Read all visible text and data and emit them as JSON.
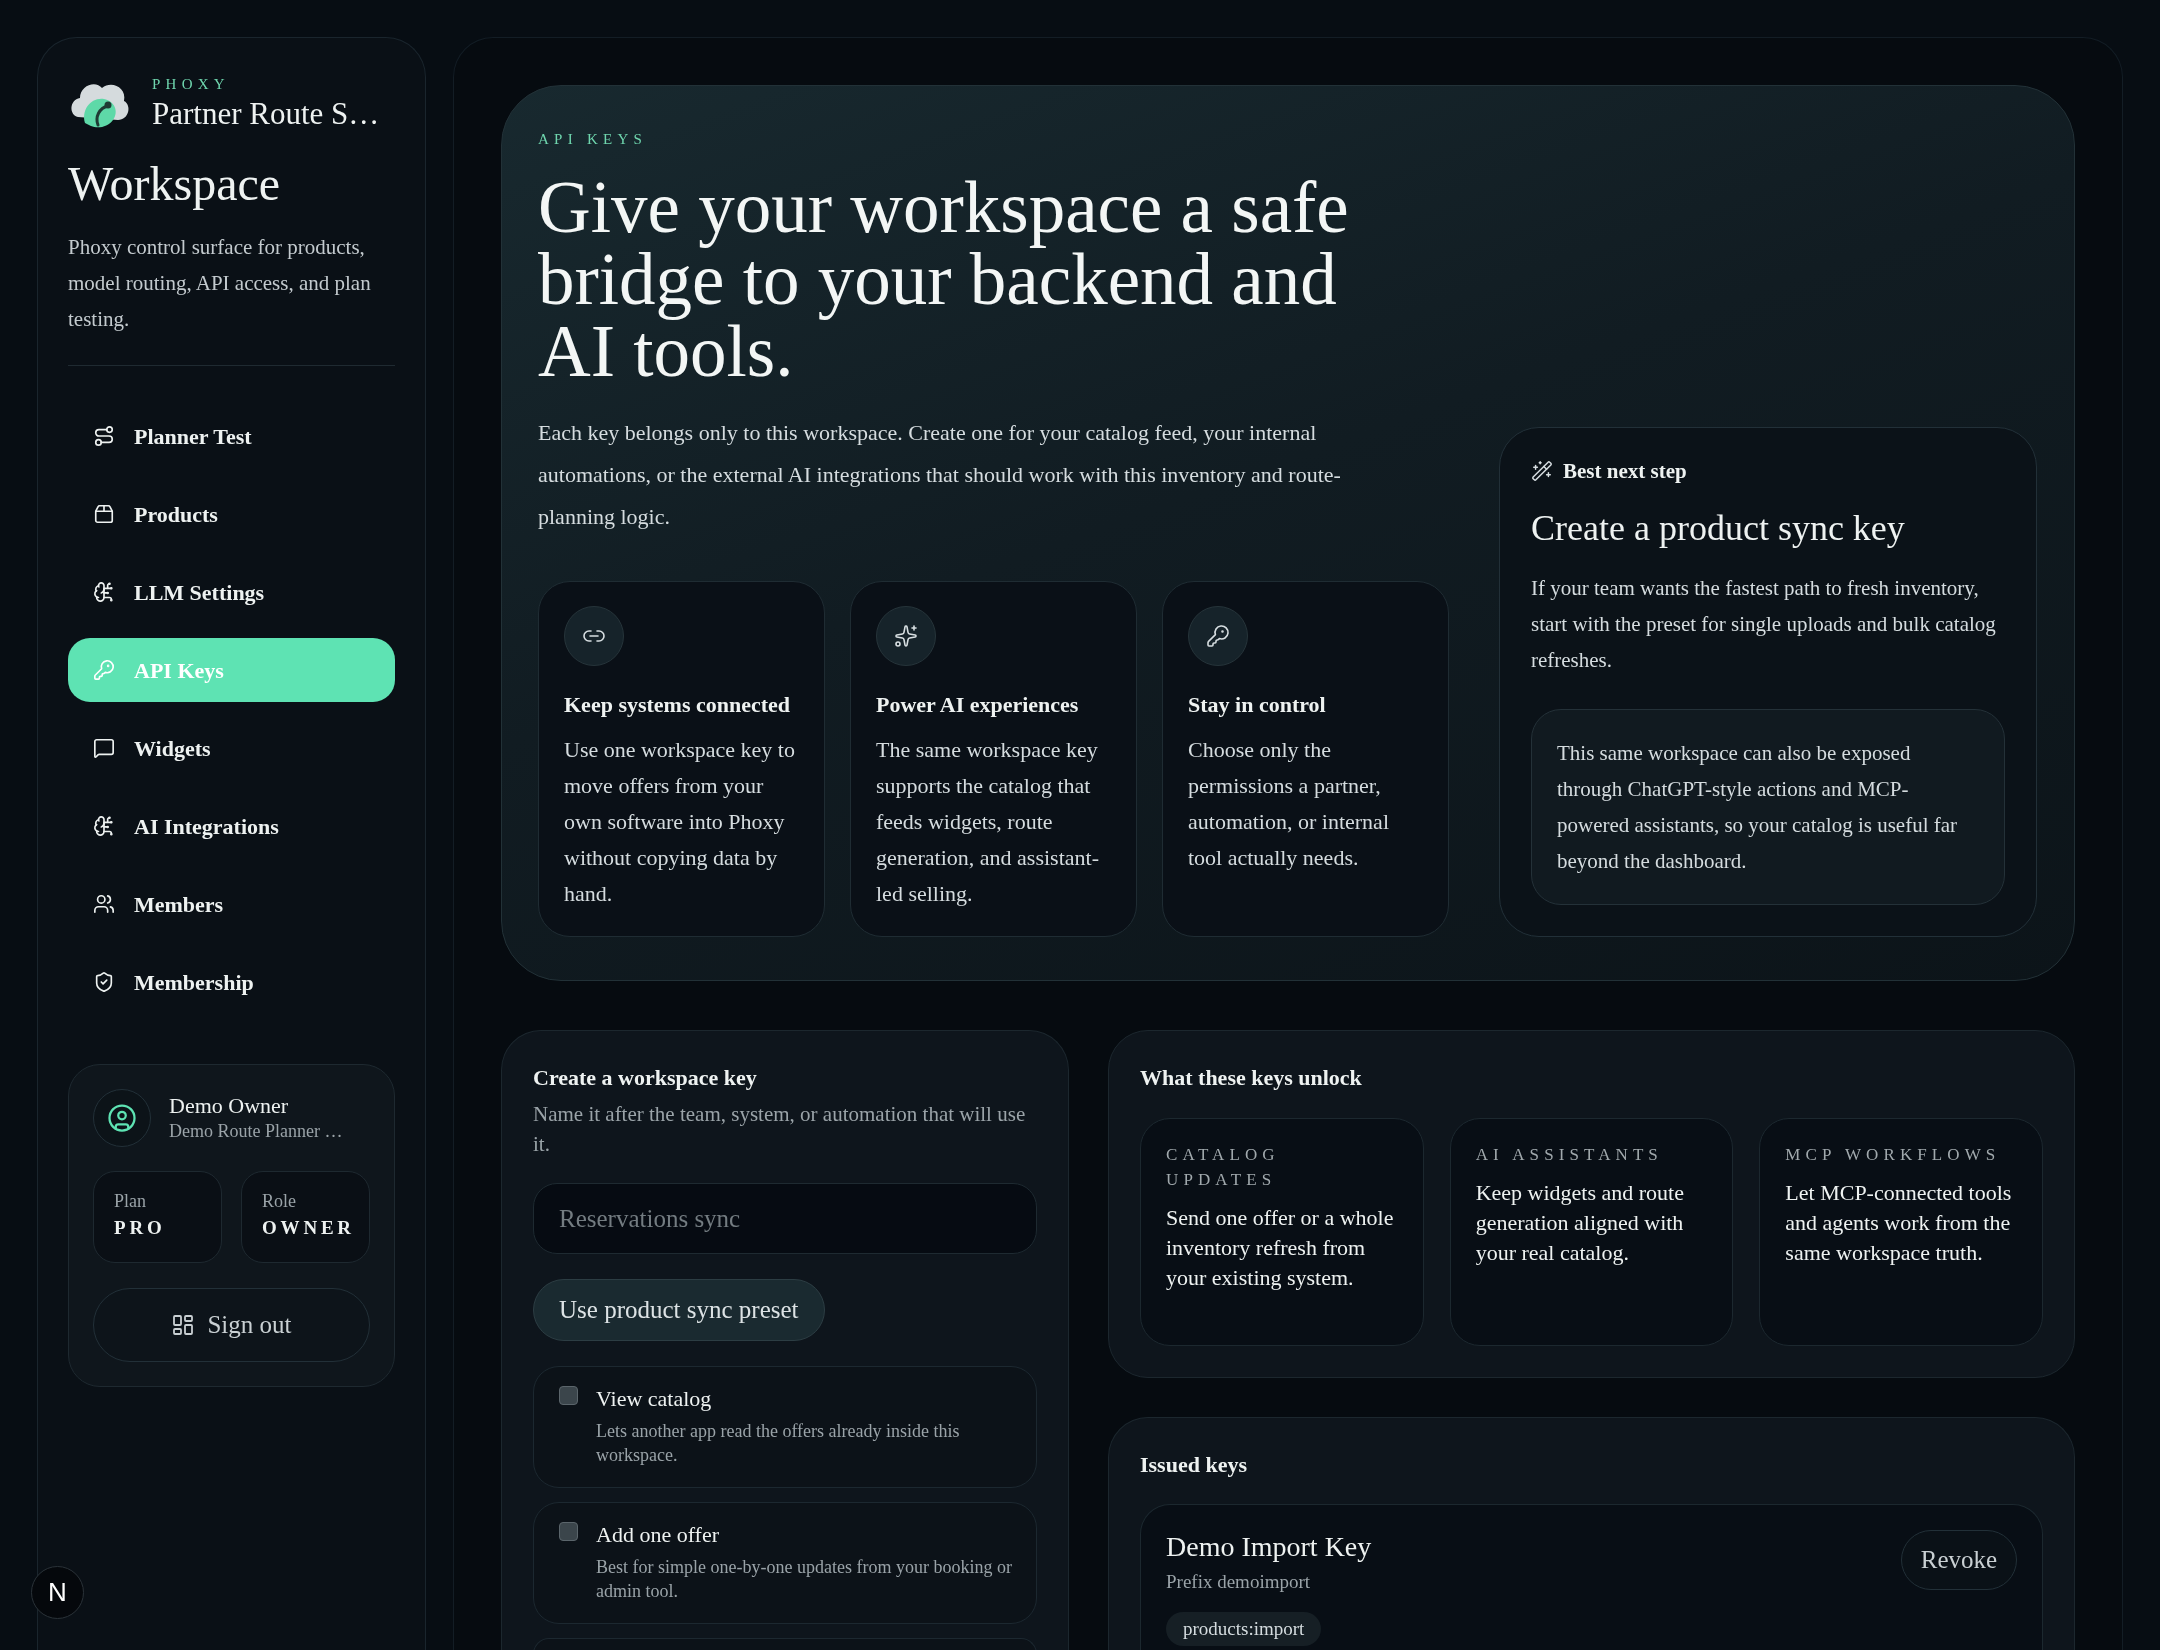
{
  "sidebar": {
    "brand": "PHOXY",
    "workspace_name": "Partner Route S…",
    "title": "Workspace",
    "description": "Phoxy control surface for products, model routing, API access, and plan testing.",
    "nav": [
      {
        "label": "Planner Test",
        "selected": false
      },
      {
        "label": "Products",
        "selected": false
      },
      {
        "label": "LLM Settings",
        "selected": false
      },
      {
        "label": "API Keys",
        "selected": true
      },
      {
        "label": "Widgets",
        "selected": false
      },
      {
        "label": "AI Integrations",
        "selected": false
      },
      {
        "label": "Members",
        "selected": false
      },
      {
        "label": "Membership",
        "selected": false
      }
    ],
    "user": {
      "name": "Demo Owner",
      "org": "Demo Route Planner …",
      "plan_label": "Plan",
      "plan": "PRO",
      "role_label": "Role",
      "role": "OWNER"
    },
    "sign_out": "Sign out"
  },
  "dev_badge": "N",
  "hero": {
    "eyebrow": "API KEYS",
    "headline": "Give your workspace a safe bridge to your backend and AI tools.",
    "intro": "Each key belongs only to this workspace. Create one for your catalog feed, your internal automations, or the external AI integrations that should work with this inventory and route-planning logic.",
    "features": [
      {
        "title": "Keep systems connected",
        "body": "Use one workspace key to move offers from your own software into Phoxy without copying data by hand."
      },
      {
        "title": "Power AI experiences",
        "body": "The same workspace key supports the catalog that feeds widgets, route generation, and assistant-led selling."
      },
      {
        "title": "Stay in control",
        "body": "Choose only the permissions a partner, automation, or internal tool actually needs."
      }
    ],
    "next_step": {
      "label": "Best next step",
      "title": "Create a product sync key",
      "body": "If your team wants the fastest path to fresh inventory, start with the preset for single uploads and bulk catalog refreshes.",
      "note": "This same workspace can also be exposed through ChatGPT-style actions and MCP-powered assistants, so your catalog is useful far beyond the dashboard."
    }
  },
  "create_key": {
    "title": "Create a workspace key",
    "subtitle": "Name it after the team, system, or automation that will use it.",
    "name_field": {
      "placeholder": "Reservations sync"
    },
    "preset_button": "Use product sync preset",
    "permissions": [
      {
        "title": "View catalog",
        "description": "Lets another app read the offers already inside this workspace.",
        "checked": false
      },
      {
        "title": "Add one offer",
        "description": "Best for simple one-by-one updates from your booking or admin tool.",
        "checked": false
      }
    ]
  },
  "unlocks": {
    "title": "What these keys unlock",
    "items": [
      {
        "label": "CATALOG UPDATES",
        "body": "Send one offer or a whole inventory refresh from your existing system."
      },
      {
        "label": "AI ASSISTANTS",
        "body": "Keep widgets and route generation aligned with your real catalog."
      },
      {
        "label": "MCP WORKFLOWS",
        "body": "Let MCP-connected tools and agents work from the same workspace truth."
      }
    ]
  },
  "issued_keys": {
    "title": "Issued keys",
    "keys": [
      {
        "name": "Demo Import Key",
        "prefix": "Prefix demoimport",
        "scopes": [
          "products:import"
        ],
        "action": "Revoke"
      }
    ]
  }
}
